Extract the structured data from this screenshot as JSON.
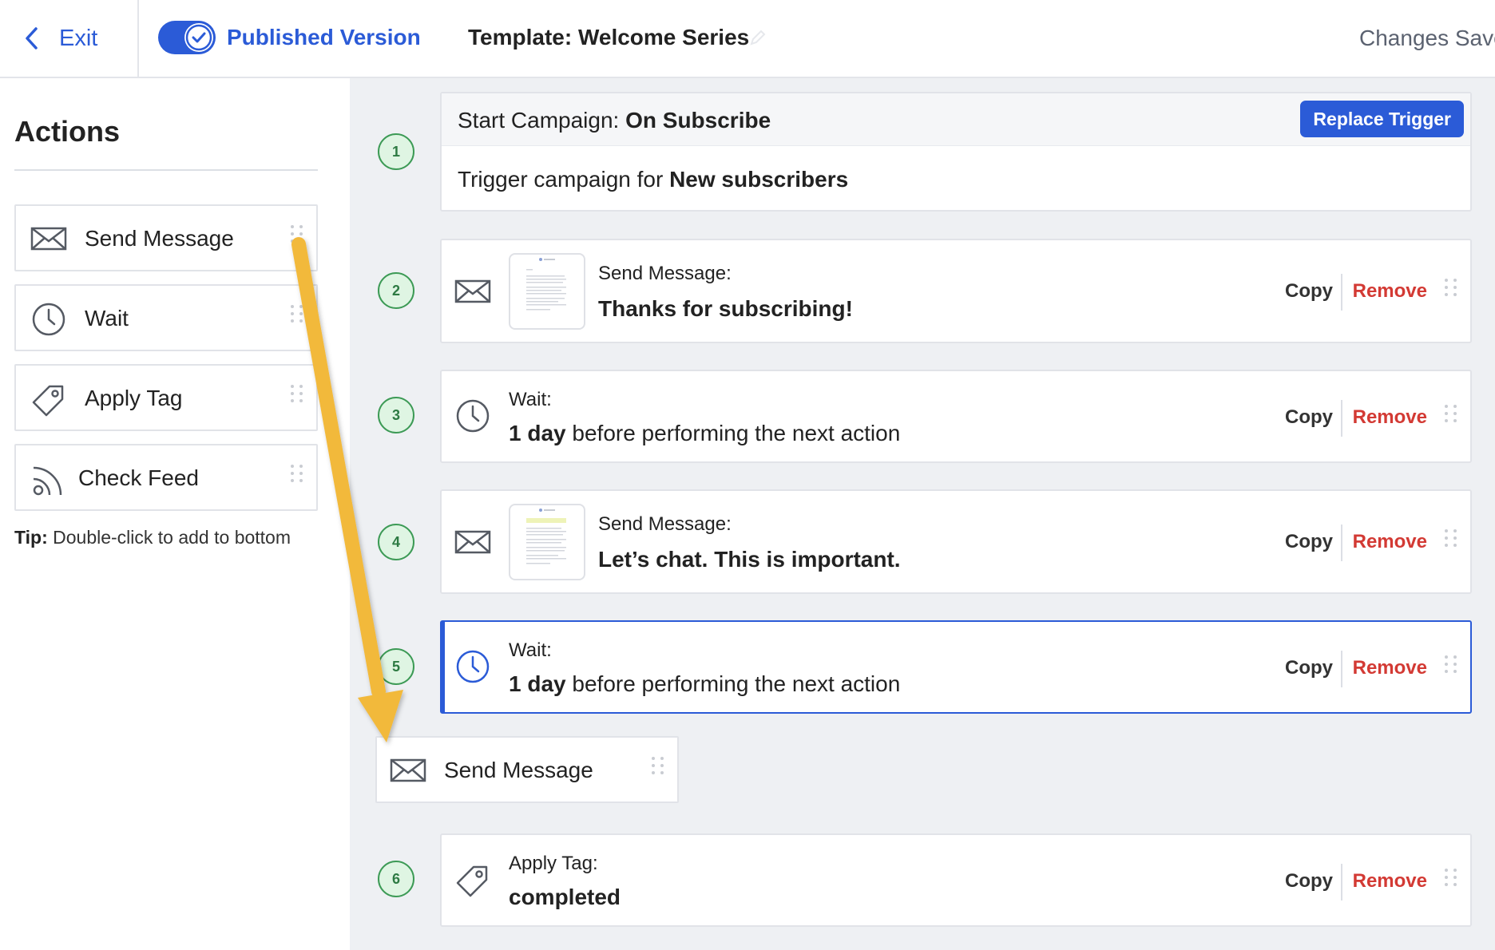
{
  "header": {
    "exit_label": "Exit",
    "published_label": "Published Version",
    "template_title": "Template: Welcome Series",
    "status_text": "Changes Save"
  },
  "sidebar": {
    "title": "Actions",
    "items": [
      {
        "label": "Send Message",
        "icon": "envelope-icon"
      },
      {
        "label": "Wait",
        "icon": "clock-icon"
      },
      {
        "label": "Apply Tag",
        "icon": "tag-icon"
      },
      {
        "label": "Check Feed",
        "icon": "rss-feed-icon"
      }
    ],
    "tip_bold": "Tip:",
    "tip_text": " Double-click to add to bottom"
  },
  "steps": {
    "s1": {
      "number": "1",
      "head_prefix": "Start Campaign: ",
      "head_bold": "On Subscribe",
      "button": "Replace Trigger",
      "body_prefix": "Trigger campaign for ",
      "body_bold": "New subscribers"
    },
    "s2": {
      "number": "2",
      "label": "Send Message:",
      "value_bold": "Thanks for subscribing!",
      "copy": "Copy",
      "remove": "Remove"
    },
    "s3": {
      "number": "3",
      "label": "Wait:",
      "value_bold": "1 day",
      "value_rest": " before performing the next action",
      "copy": "Copy",
      "remove": "Remove"
    },
    "s4": {
      "number": "4",
      "label": "Send Message:",
      "value_bold": "Let’s chat. This is important.",
      "copy": "Copy",
      "remove": "Remove"
    },
    "s5": {
      "number": "5",
      "label": "Wait:",
      "value_bold": "1 day",
      "value_rest": " before performing the next action",
      "copy": "Copy",
      "remove": "Remove"
    },
    "s6": {
      "number": "6",
      "label": "Apply Tag:",
      "value_bold": "completed",
      "copy": "Copy",
      "remove": "Remove"
    }
  },
  "dragging": {
    "label": "Send Message"
  },
  "colors": {
    "accent": "#2b5bd7",
    "remove": "#d33a34",
    "step_badge": "#3c9a55",
    "arrow": "#f2b93b"
  }
}
